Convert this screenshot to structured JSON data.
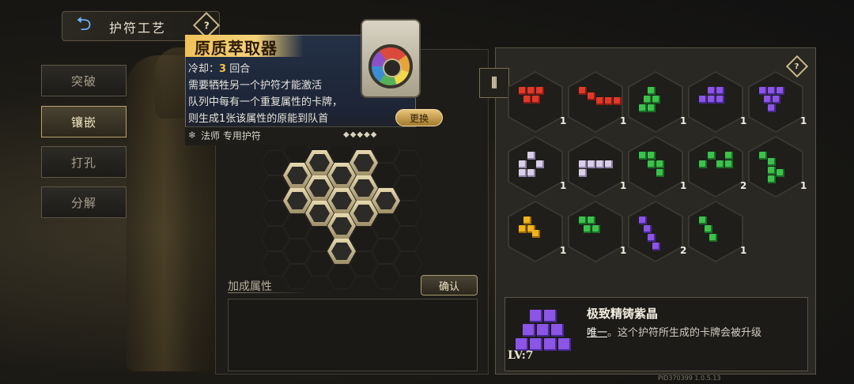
{
  "header": {
    "title": "护符工艺",
    "back_icon": "back-arrow-icon",
    "help_icon": "question-diamond-icon"
  },
  "tabs": [
    {
      "label": "突破",
      "active": false
    },
    {
      "label": "镶嵌",
      "active": true
    },
    {
      "label": "打孔",
      "active": false
    },
    {
      "label": "分解",
      "active": false
    }
  ],
  "tooltip": {
    "name": "原质萃取器",
    "cooldown_label": "冷却：",
    "cooldown_value": "3",
    "cooldown_unit": "回合",
    "line1": "需要牺牲另一个护符才能激活",
    "line2": "队列中每有一个重复属性的卡牌，",
    "line3": "则生成1张该属性的原能到队首",
    "class_label": "法师 专用护符",
    "change_button": "更换"
  },
  "board": {
    "bonus_label": "加成属性",
    "confirm_button": "确认"
  },
  "gems": [
    {
      "color": "red",
      "count": "1"
    },
    {
      "color": "red",
      "count": "1"
    },
    {
      "color": "green",
      "count": "1"
    },
    {
      "color": "purple",
      "count": "1"
    },
    {
      "color": "purple",
      "count": "1"
    },
    {
      "color": "white",
      "count": "1"
    },
    {
      "color": "white",
      "count": "1"
    },
    {
      "color": "green",
      "count": "1"
    },
    {
      "color": "green",
      "count": "2"
    },
    {
      "color": "green",
      "count": "1"
    },
    {
      "color": "yellow",
      "count": "1"
    },
    {
      "color": "green",
      "count": "1"
    },
    {
      "color": "purple",
      "count": "2"
    },
    {
      "color": "green",
      "count": "1"
    }
  ],
  "detail": {
    "name": "极致精铸紫晶",
    "unique": "唯一",
    "desc": "。这个护符所生成的卡牌会被升级",
    "level": "LV:7"
  },
  "footer": {
    "pid": "PID370399  1.0.5.13"
  }
}
